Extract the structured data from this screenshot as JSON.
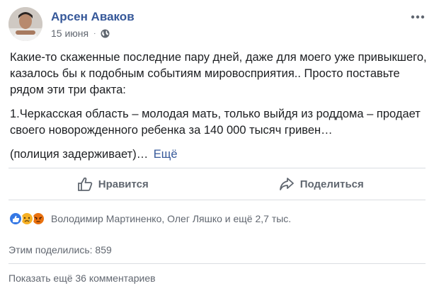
{
  "post": {
    "author": "Арсен Аваков",
    "date": "15 июня",
    "privacy_icon": "globe-icon",
    "more_icon": "ellipsis-icon",
    "paragraphs": [
      "Какие-то скаженные последние пару дней, даже для моего уже привыкшего, казалось бы к подобным событиям мировосприятия.. Просто поставьте рядом эти три факта:",
      "1.Черкасская область – молодая мать, только выйдя из роддома – продает своего новорожденного ребенка за 140 000 тысяч гривен…"
    ],
    "truncated_line": "(полиция задерживает)…",
    "see_more": "Ещё"
  },
  "actions": {
    "like_label": "Нравится",
    "share_label": "Поделиться"
  },
  "reactions": {
    "icons": [
      "like-reaction-icon",
      "sad-reaction-icon",
      "angry-reaction-icon"
    ],
    "summary": "Володимир Мартиненко, Олег Ляшко и ещё 2,7 тыс."
  },
  "shares": "Этим поделились: 859",
  "comments": "Показать ещё 36 комментариев",
  "colors": {
    "link": "#365899",
    "secondary_text": "#616770",
    "divider": "#dadde1",
    "like": "#3578e5",
    "sad": "#f7b125",
    "angry": "#e9710f"
  }
}
